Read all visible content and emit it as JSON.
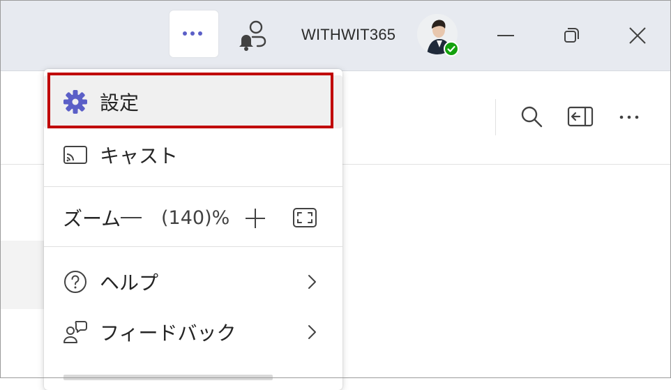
{
  "titlebar": {
    "more_button_icon": "ellipsis-icon",
    "notification_icon": "person-bell-icon",
    "account_name": "WITHWIT365",
    "presence_status": "available",
    "window_controls": [
      "minimize-icon",
      "restore-icon",
      "close-icon"
    ]
  },
  "toolbar": {
    "icons": [
      "search-icon",
      "panel-collapse-icon",
      "more-options-icon"
    ]
  },
  "menu": {
    "settings_label": "設定",
    "cast_label": "キャスト",
    "zoom_label": "ズーム",
    "zoom_value": "(140)%",
    "help_label": "ヘルプ",
    "feedback_label": "フィードバック"
  },
  "colors": {
    "accent": "#5b5fc7",
    "highlight_border": "#c00000",
    "titlebar_bg": "#e7eaf0",
    "presence": "#13a10e"
  }
}
